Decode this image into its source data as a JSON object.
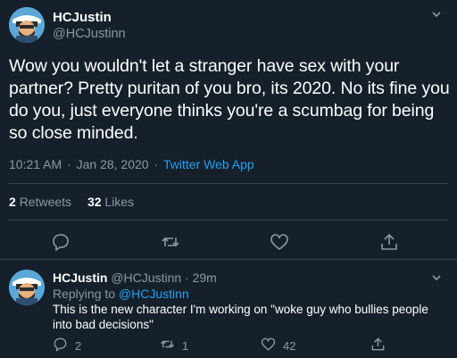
{
  "main_tweet": {
    "display_name": "HCJustin",
    "handle": "@HCJustinn",
    "text": "Wow you wouldn't let a stranger have sex with your partner?  Pretty puritan of you bro, its 2020.  No its fine you do you, just everyone thinks you're a scumbag for being so close minded.",
    "time": "10:21 AM",
    "date": "Jan 28, 2020",
    "source": "Twitter Web App",
    "retweets_count": "2",
    "retweets_label": "Retweets",
    "likes_count": "32",
    "likes_label": "Likes"
  },
  "reply_tweet": {
    "display_name": "HCJustin",
    "handle": "@HCJustinn",
    "age": "29m",
    "replying_label": "Replying to",
    "replying_to": "@HCJustinn",
    "text": "This is the new character I'm working on \"woke guy who bullies people into bad decisions\"",
    "reply_count": "2",
    "retweet_count": "1",
    "like_count": "42"
  },
  "colors": {
    "background": "#15202b",
    "muted": "#8899a6",
    "link": "#1da1f2",
    "divider": "#38444d"
  },
  "icons": [
    "reply-icon",
    "retweet-icon",
    "like-icon",
    "share-icon",
    "chevron-down-icon"
  ]
}
